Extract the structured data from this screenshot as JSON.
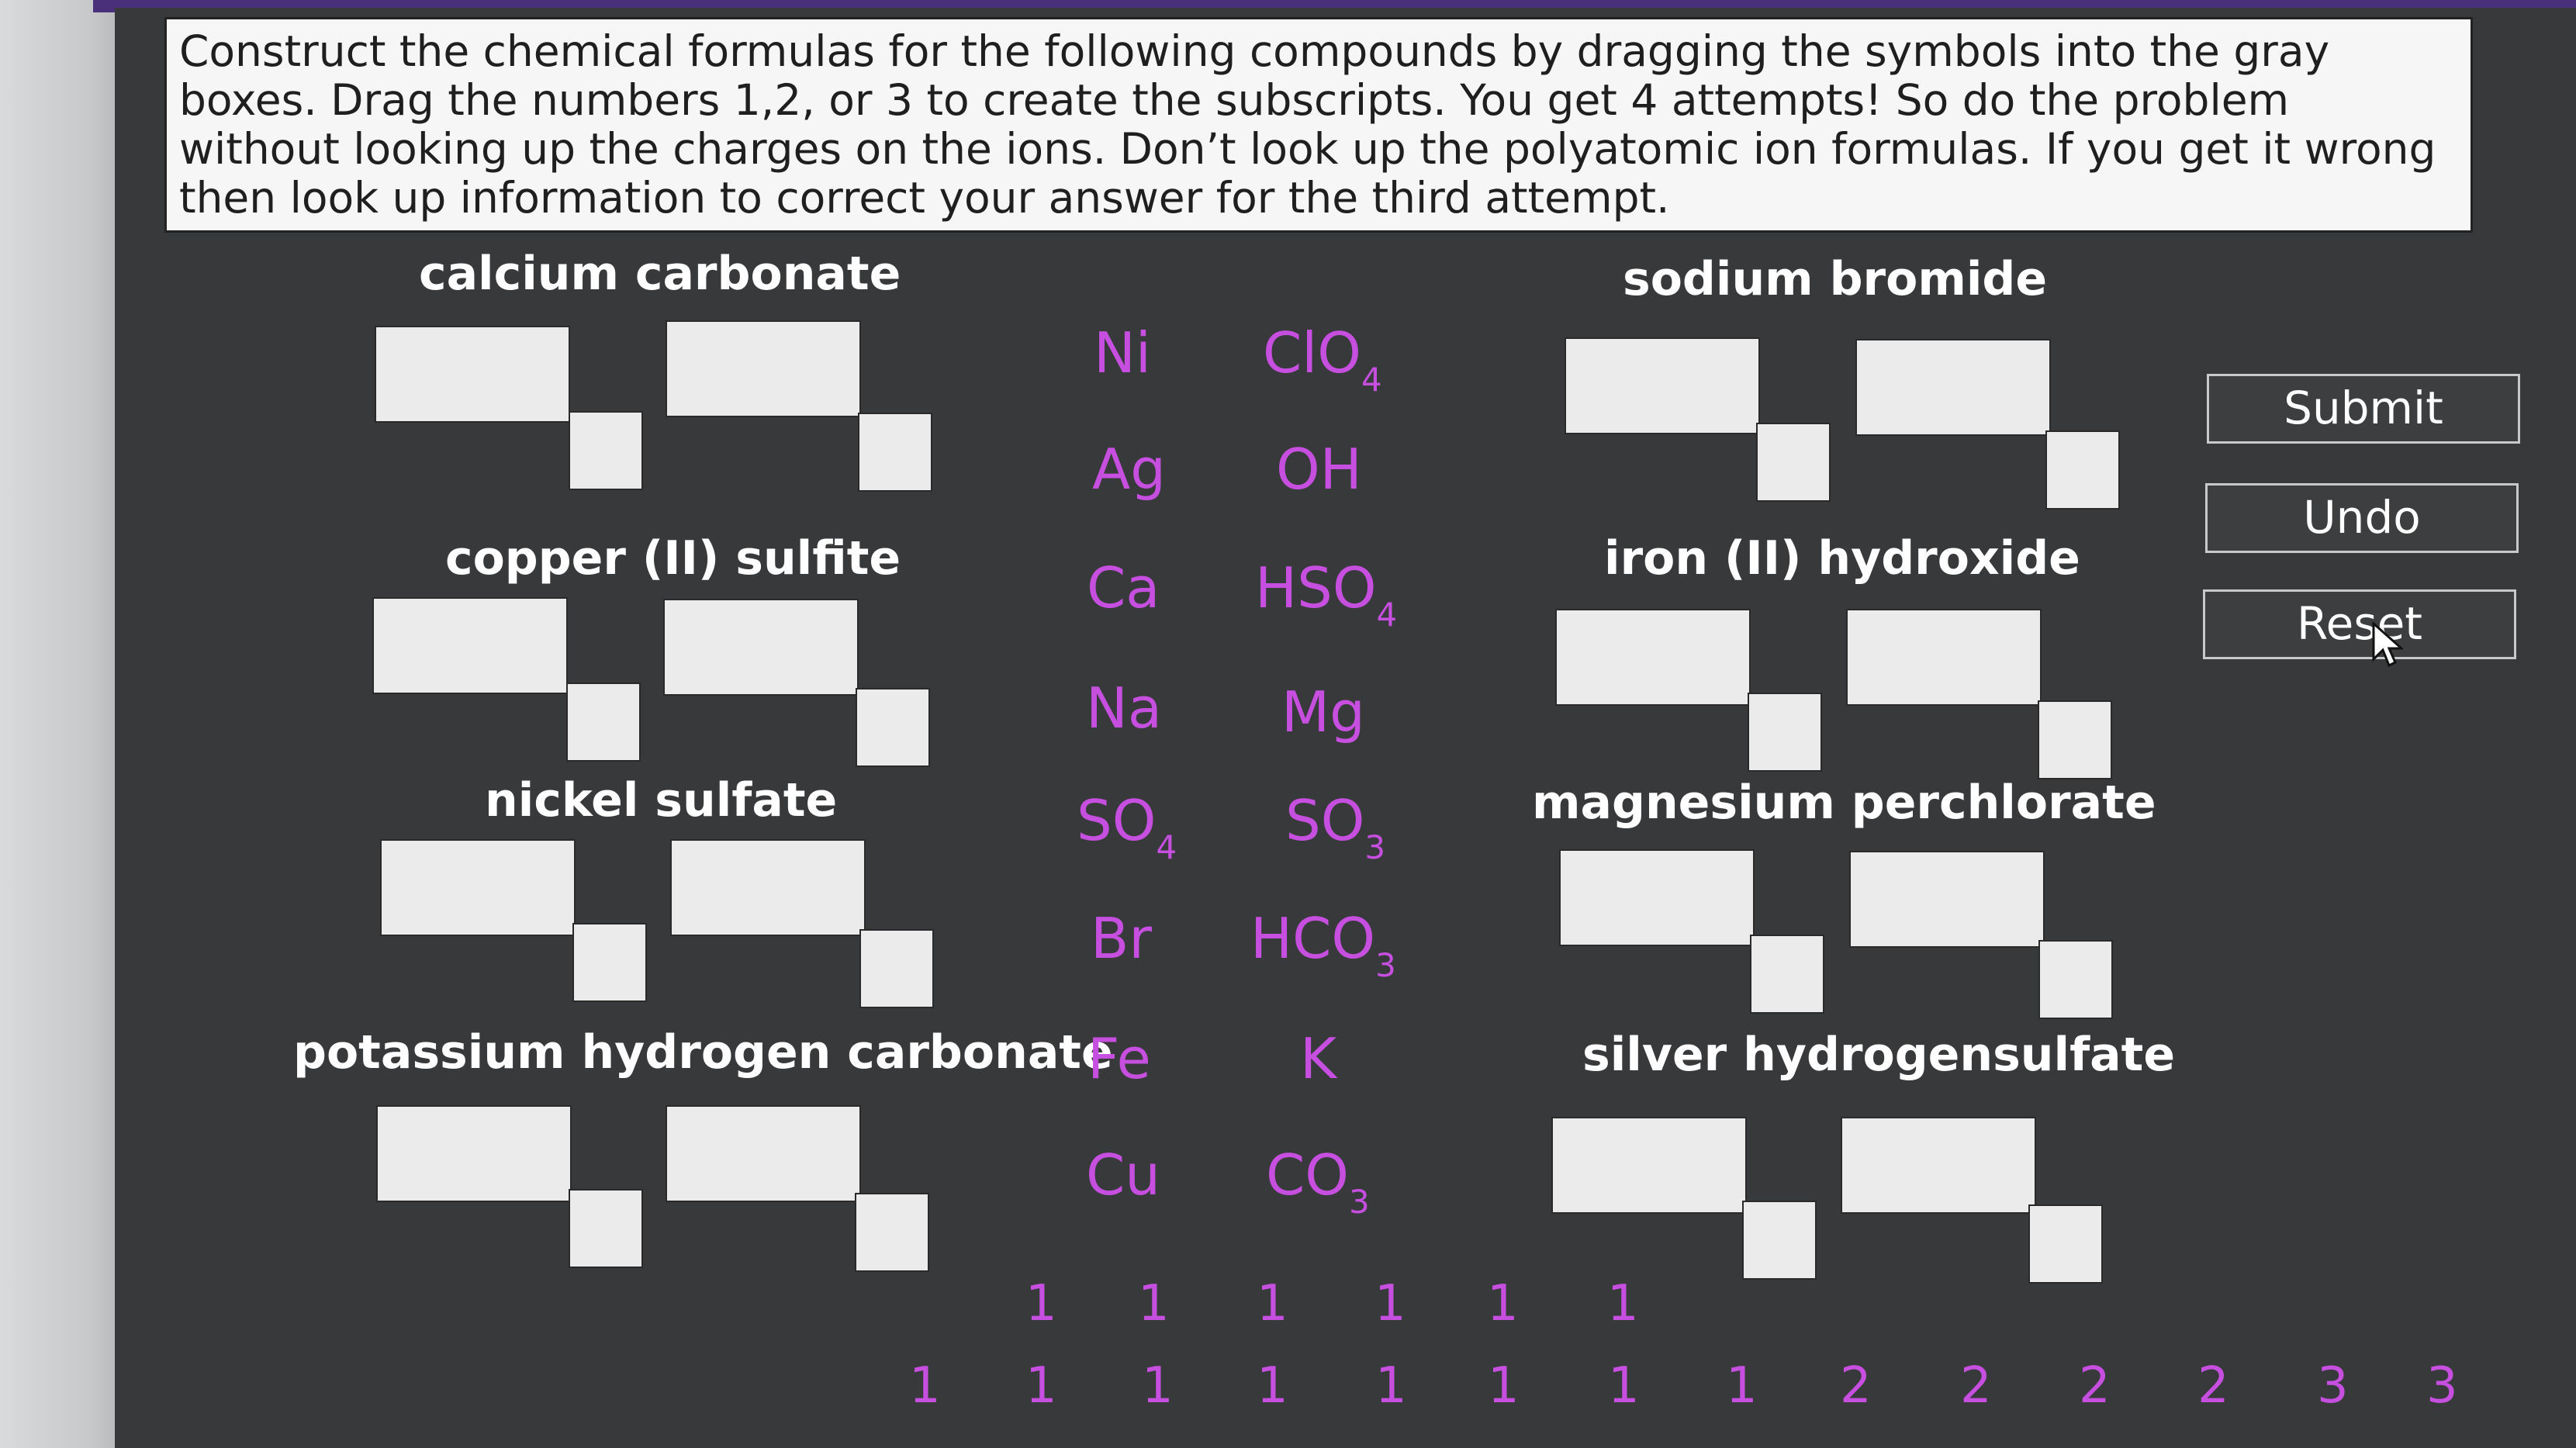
{
  "instructions": "Construct the chemical formulas for the following compounds by dragging the symbols into the gray boxes.  Drag the numbers 1,2, or 3 to create the subscripts.  You get 4 attempts! So do the problem without looking up the charges on the ions.  Don’t look up the polyatomic ion formulas.  If you get it wrong then look up information to correct your answer for the third attempt.",
  "compounds": [
    {
      "name": "calcium carbonate"
    },
    {
      "name": "copper (II) sulfite"
    },
    {
      "name": "nickel sulfate"
    },
    {
      "name": "potassium hydrogen carbonate"
    },
    {
      "name": "sodium bromide"
    },
    {
      "name": "iron (II) hydroxide"
    },
    {
      "name": "magnesium perchlorate"
    },
    {
      "name": "silver hydrogensulfate"
    }
  ],
  "symbols": [
    {
      "main": "Ni",
      "sub": ""
    },
    {
      "main": "ClO",
      "sub": "4"
    },
    {
      "main": "Ag",
      "sub": ""
    },
    {
      "main": "OH",
      "sub": ""
    },
    {
      "main": "Ca",
      "sub": ""
    },
    {
      "main": "HSO",
      "sub": "4"
    },
    {
      "main": "Na",
      "sub": ""
    },
    {
      "main": "Mg",
      "sub": ""
    },
    {
      "main": "SO",
      "sub": "4"
    },
    {
      "main": "SO",
      "sub": "3"
    },
    {
      "main": "Br",
      "sub": ""
    },
    {
      "main": "HCO",
      "sub": "3"
    },
    {
      "main": "Fe",
      "sub": ""
    },
    {
      "main": "K",
      "sub": ""
    },
    {
      "main": "Cu",
      "sub": ""
    },
    {
      "main": "CO",
      "sub": "3"
    }
  ],
  "numbers_row1": [
    "1",
    "1",
    "1",
    "1",
    "1",
    "1"
  ],
  "numbers_row2": [
    "1",
    "1",
    "1",
    "1",
    "1",
    "1",
    "1",
    "1",
    "2",
    "2",
    "2",
    "2",
    "3",
    "3"
  ],
  "buttons": {
    "submit": "Submit",
    "undo": "Undo",
    "reset": "Reset"
  },
  "colors": {
    "panel": "#37393b",
    "symbol": "#c64fe0",
    "drop_box": "#ebebeb"
  }
}
